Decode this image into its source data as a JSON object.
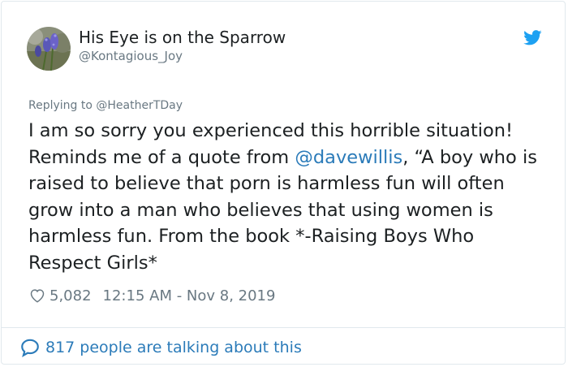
{
  "user": {
    "display_name": "His Eye is on the Sparrow",
    "handle": "@Kontagious_Joy"
  },
  "reply": {
    "prefix": "Replying to ",
    "mention": "@HeatherTDay"
  },
  "tweet": {
    "text_part1": "I am so sorry you experienced this horrible situation! Reminds me of a quote from ",
    "mention": "@davewillis",
    "text_part2": ", “A boy who is raised to believe that porn is harmless fun will often grow into a man who believes that using women is harmless fun. From the book *-Raising Boys Who Respect Girls*"
  },
  "meta": {
    "like_count": "5,082",
    "timestamp": "12:15 AM - Nov 8, 2019"
  },
  "footer": {
    "conversation_label": "817 people are talking about this"
  },
  "icons": {
    "bird": "twitter-bird-icon",
    "like": "heart-icon",
    "reply": "speech-bubble-icon"
  },
  "colors": {
    "link": "#2b7bb9",
    "twitter_blue": "#1da1f2",
    "muted": "#697882",
    "text": "#1c2022"
  }
}
